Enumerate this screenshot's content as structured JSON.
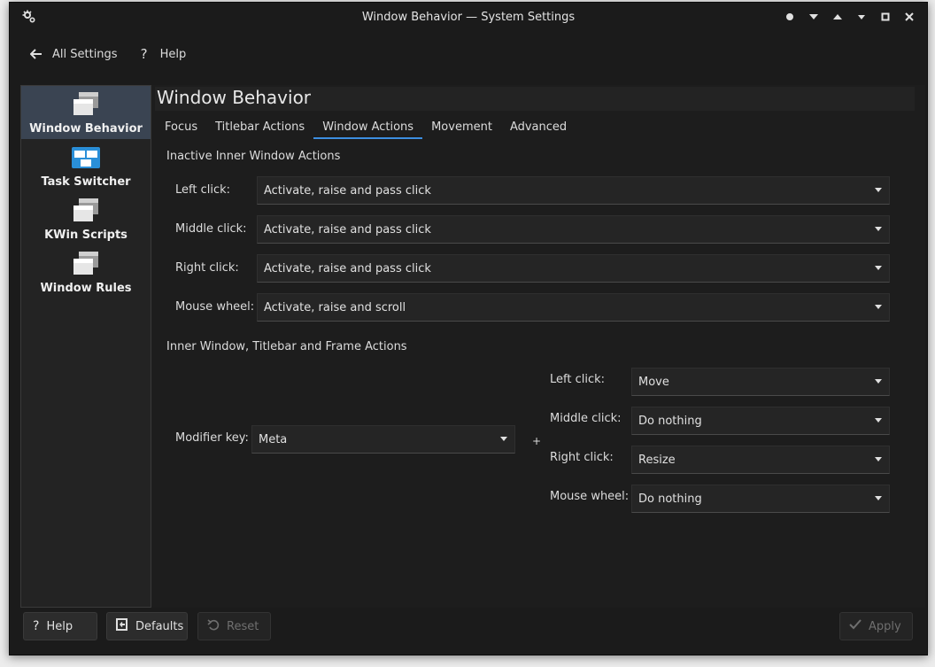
{
  "window": {
    "title": "Window Behavior — System Settings"
  },
  "header": {
    "back_label": "All Settings",
    "help_label": "Help"
  },
  "sidebar": {
    "items": [
      {
        "label": "Window Behavior",
        "icon": "window-behavior-icon",
        "active": true
      },
      {
        "label": "Task Switcher",
        "icon": "task-switcher-icon",
        "active": false
      },
      {
        "label": "KWin Scripts",
        "icon": "kwin-scripts-icon",
        "active": false
      },
      {
        "label": "Window Rules",
        "icon": "window-rules-icon",
        "active": false
      }
    ]
  },
  "page": {
    "title": "Window Behavior",
    "tabs": [
      "Focus",
      "Titlebar Actions",
      "Window Actions",
      "Movement",
      "Advanced"
    ],
    "active_tab": "Window Actions"
  },
  "inactive": {
    "heading": "Inactive Inner Window Actions",
    "rows": [
      {
        "label": "Left click:",
        "value": "Activate, raise and pass click"
      },
      {
        "label": "Middle click:",
        "value": "Activate, raise and pass click"
      },
      {
        "label": "Right click:",
        "value": "Activate, raise and pass click"
      },
      {
        "label": "Mouse wheel:",
        "value": "Activate, raise and scroll"
      }
    ]
  },
  "inner": {
    "heading": "Inner Window, Titlebar and Frame Actions",
    "modifier_label": "Modifier key:",
    "modifier_value": "Meta",
    "plus": "+",
    "rows": [
      {
        "label": "Left click:",
        "value": "Move"
      },
      {
        "label": "Middle click:",
        "value": "Do nothing"
      },
      {
        "label": "Right click:",
        "value": "Resize"
      },
      {
        "label": "Mouse wheel:",
        "value": "Do nothing"
      }
    ]
  },
  "footer": {
    "help_label": "Help",
    "defaults_label": "Defaults",
    "reset_label": "Reset",
    "apply_label": "Apply"
  },
  "colors": {
    "accent": "#3d8ee0",
    "active_item": "#3a4452",
    "background": "#1b1b1b"
  }
}
